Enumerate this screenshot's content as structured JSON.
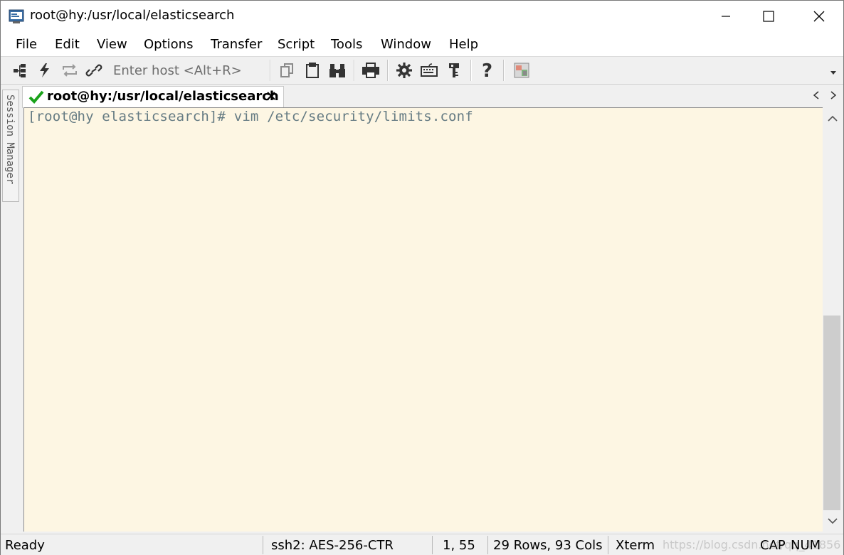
{
  "window": {
    "title": "root@hy:/usr/local/elasticsearch"
  },
  "menu": [
    "File",
    "Edit",
    "View",
    "Options",
    "Transfer",
    "Script",
    "Tools",
    "Window",
    "Help"
  ],
  "toolbar": {
    "host_placeholder": "Enter host <Alt+R>",
    "icons": [
      "connect-icon",
      "lightning-icon",
      "reconnect-icon",
      "link-icon",
      "copy-icon",
      "paste-icon",
      "find-icon",
      "print-icon",
      "settings-icon",
      "keymap-icon",
      "key-icon",
      "help-icon",
      "sftp-icon"
    ]
  },
  "tab": {
    "title": "root@hy:/usr/local/elasticsearch",
    "status_color": "#1aa21a"
  },
  "session_manager": {
    "label": "Session Manager"
  },
  "terminal": {
    "lines": [
      "[root@hy elasticsearch]# vim /etc/security/limits.conf"
    ],
    "background": "#fdf6e3",
    "foreground": "#657b83"
  },
  "status": {
    "state": "Ready",
    "cipher": "ssh2: AES-256-CTR",
    "cursor": "1,  55",
    "size": "29 Rows, 93 Cols",
    "term": "Xterm",
    "cap": "CAP",
    "num": "NUM",
    "watermark": "https://blog.csdn.net/qq_41856"
  }
}
